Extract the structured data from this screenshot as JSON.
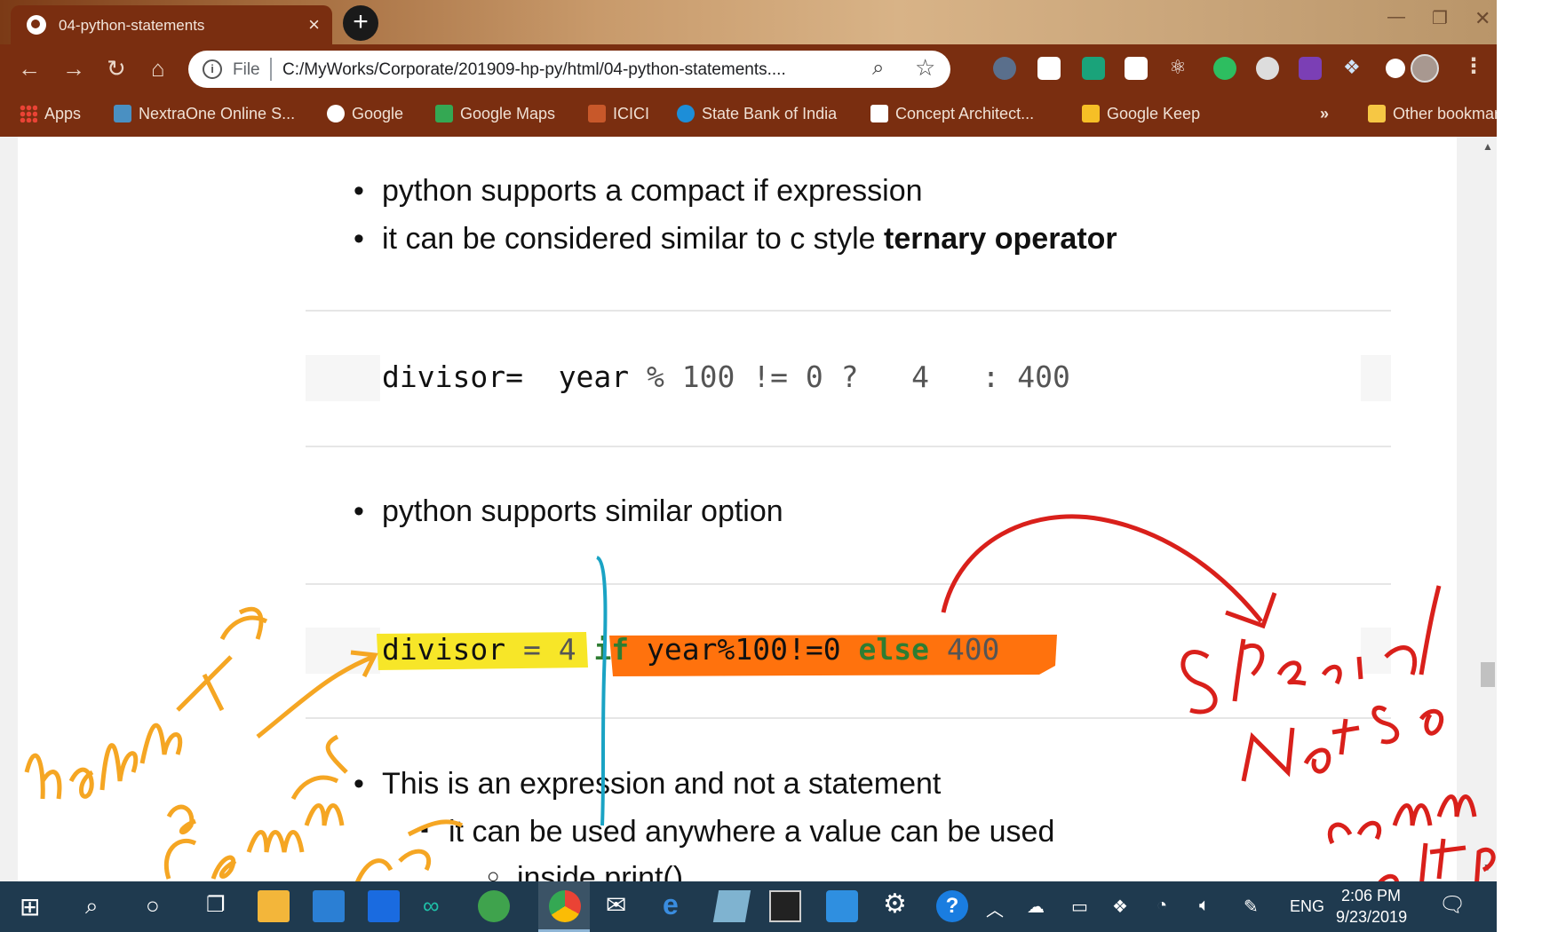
{
  "browser": {
    "tab_title": "04-python-statements",
    "tab_close": "×",
    "new_tab": "+",
    "scheme_label": "File",
    "url": "C:/MyWorks/Corporate/201909-hp-py/html/04-python-statements....",
    "bookmarks": [
      {
        "label": "Apps",
        "icon": "apps-grid-icon"
      },
      {
        "label": "NextraOne Online S...",
        "icon": "nextraone-icon"
      },
      {
        "label": "Google",
        "icon": "google-icon"
      },
      {
        "label": "Google Maps",
        "icon": "google-maps-icon"
      },
      {
        "label": "ICICI",
        "icon": "icici-icon"
      },
      {
        "label": "State Bank of India",
        "icon": "sbi-icon"
      },
      {
        "label": "Concept Architect...",
        "icon": "gmail-icon"
      },
      {
        "label": "Google Keep",
        "icon": "google-keep-icon"
      }
    ],
    "overflow_label": "»",
    "other_bookmarks": "Other bookmarks"
  },
  "page": {
    "bullets_top": [
      "python supports a compact if expression",
      "it can be considered similar to c style "
    ],
    "ternary_bold": "ternary operator",
    "code1": {
      "lhs": "divisor=",
      "expr": "  year ",
      "op1": "%",
      "n100": " 100 ",
      "op2": "!=",
      "n0": " 0 ",
      "q": "?",
      "n4": "   4   ",
      "colon": ":",
      "n400": " 400"
    },
    "bullet_mid": "python supports similar option",
    "code2": {
      "lhs": "divisor",
      "eq": " = ",
      "four": "4 ",
      "kw_if": "if",
      "cond": " year%100!=0 ",
      "kw_else": "else",
      "n400": " 400"
    },
    "bullet_expr": "This is an expression and not a statement",
    "sub_bullet": "it can be used anywhere a value can be used",
    "sub_sub_bullet": "inside print()"
  },
  "annotations": {
    "left_note": "happy path",
    "left_note_2": "a common use case",
    "right_note": "Special",
    "right_note_2": "Not so common alt path",
    "colors": {
      "orange": "#f5a623",
      "red": "#d9201b",
      "teal": "#1aa3c4",
      "yellow": "#f7e51c",
      "highlight_orange": "#ff6a00"
    }
  },
  "taskbar": {
    "language": "ENG",
    "time": "2:06 PM",
    "date": "9/23/2019"
  },
  "colors": {
    "chrome_dark": "#7a2e10",
    "taskbar": "#1f3a4f"
  }
}
